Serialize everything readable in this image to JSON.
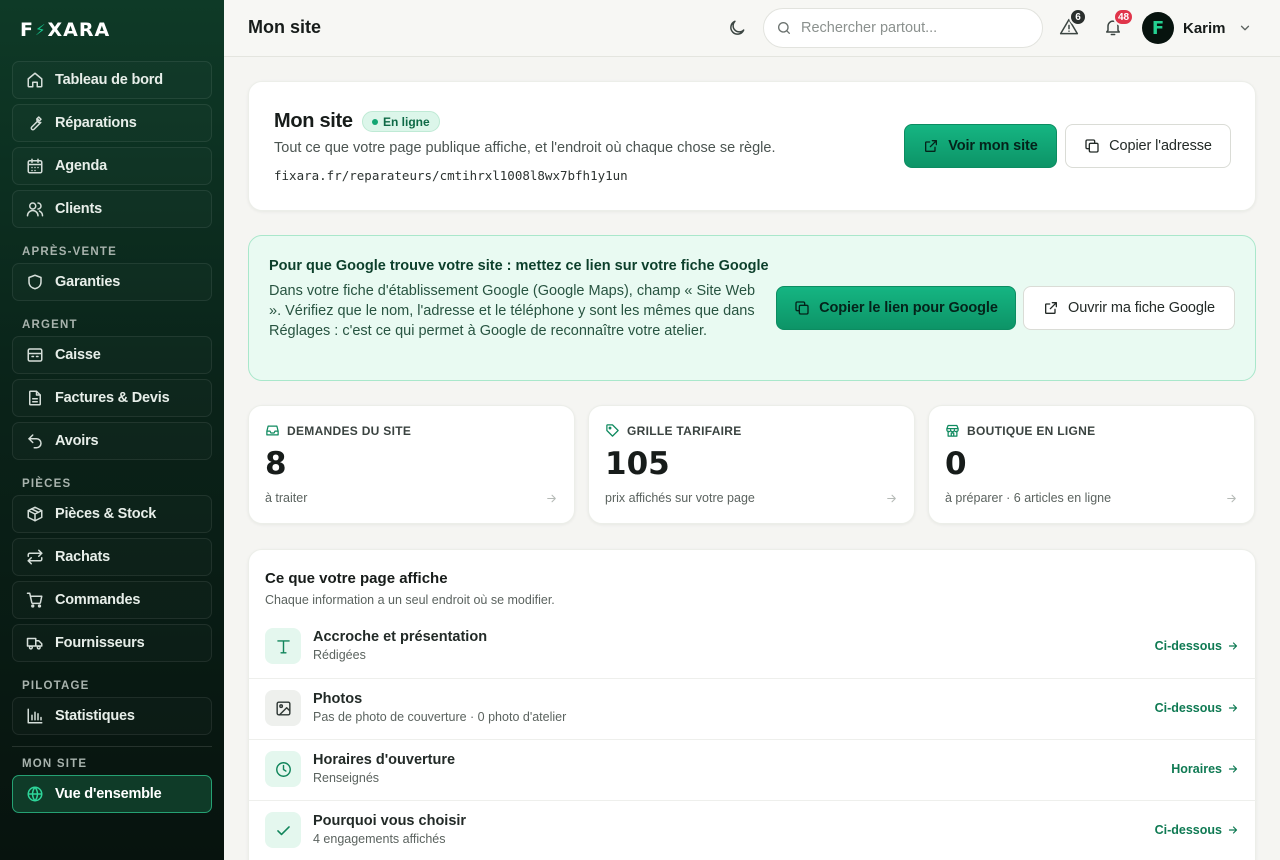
{
  "app": {
    "brand_left": "F",
    "brand_right": "XARA"
  },
  "colors": {
    "accent": "#10a573",
    "sidebar_bg": "#0a2319",
    "badge_red": "#e0354a",
    "badge_dark": "#2a2f2d"
  },
  "sidebar": {
    "items_top": [
      {
        "label": "Tableau de bord",
        "icon": "home-icon"
      },
      {
        "label": "Réparations",
        "icon": "wrench-icon"
      },
      {
        "label": "Agenda",
        "icon": "calendar-icon"
      },
      {
        "label": "Clients",
        "icon": "users-icon"
      }
    ],
    "sections": [
      {
        "title": "APRÈS-VENTE",
        "items": [
          {
            "label": "Garanties",
            "icon": "shield-icon"
          }
        ]
      },
      {
        "title": "ARGENT",
        "items": [
          {
            "label": "Caisse",
            "icon": "register-icon"
          },
          {
            "label": "Factures & Devis",
            "icon": "file-icon"
          },
          {
            "label": "Avoirs",
            "icon": "undo-icon"
          }
        ]
      },
      {
        "title": "PIÈCES",
        "items": [
          {
            "label": "Pièces & Stock",
            "icon": "box-icon"
          },
          {
            "label": "Rachats",
            "icon": "swap-icon"
          },
          {
            "label": "Commandes",
            "icon": "cart-icon"
          },
          {
            "label": "Fournisseurs",
            "icon": "truck-icon"
          }
        ]
      },
      {
        "title": "PILOTAGE",
        "items": [
          {
            "label": "Statistiques",
            "icon": "bar-chart-icon"
          }
        ]
      },
      {
        "title": "MON SITE",
        "items": [
          {
            "label": "Vue d'ensemble",
            "icon": "globe-icon",
            "active": true
          }
        ]
      }
    ]
  },
  "header": {
    "title": "Mon site",
    "search_placeholder": "Rechercher partout...",
    "alerts_count": "6",
    "notifications_count": "48",
    "user_initial": "F",
    "user_name": "Karim"
  },
  "site": {
    "title": "Mon site",
    "status": "En ligne",
    "description": "Tout ce que votre page publique affiche, et l'endroit où chaque chose se règle.",
    "url": "fixara.fr/reparateurs/cmtihrxl1008l8wx7bfh1y1un",
    "view_button": "Voir mon site",
    "copy_button": "Copier l'adresse"
  },
  "google": {
    "title": "Pour que Google trouve votre site : mettez ce lien sur votre fiche Google",
    "text": "Dans votre fiche d'établissement Google (Google Maps), champ « Site Web ». Vérifiez que le nom, l'adresse et le téléphone y sont les mêmes que dans Réglages : c'est ce qui permet à Google de reconnaître votre atelier.",
    "copy_button": "Copier le lien pour Google",
    "open_button": "Ouvrir ma fiche Google"
  },
  "stats": [
    {
      "label": "DEMANDES DU SITE",
      "value": "8",
      "sub": "à traiter",
      "icon": "inbox-icon"
    },
    {
      "label": "GRILLE TARIFAIRE",
      "value": "105",
      "sub": "prix affichés sur votre page",
      "icon": "tag-icon"
    },
    {
      "label": "BOUTIQUE EN LIGNE",
      "value": "0",
      "sub": "à préparer · 6 articles en ligne",
      "icon": "store-icon"
    }
  ],
  "content": {
    "title": "Ce que votre page affiche",
    "subtitle": "Chaque information a un seul endroit où se modifier.",
    "rows": [
      {
        "name": "Accroche et présentation",
        "desc": "Rédigées",
        "link": "Ci-dessous",
        "icon": "text-icon"
      },
      {
        "name": "Photos",
        "desc": "Pas de photo de couverture · 0 photo d'atelier",
        "link": "Ci-dessous",
        "icon": "image-icon"
      },
      {
        "name": "Horaires d'ouverture",
        "desc": "Renseignés",
        "link": "Horaires",
        "icon": "clock-icon"
      },
      {
        "name": "Pourquoi vous choisir",
        "desc": "4 engagements affichés",
        "link": "Ci-dessous",
        "icon": "check-icon"
      }
    ]
  }
}
